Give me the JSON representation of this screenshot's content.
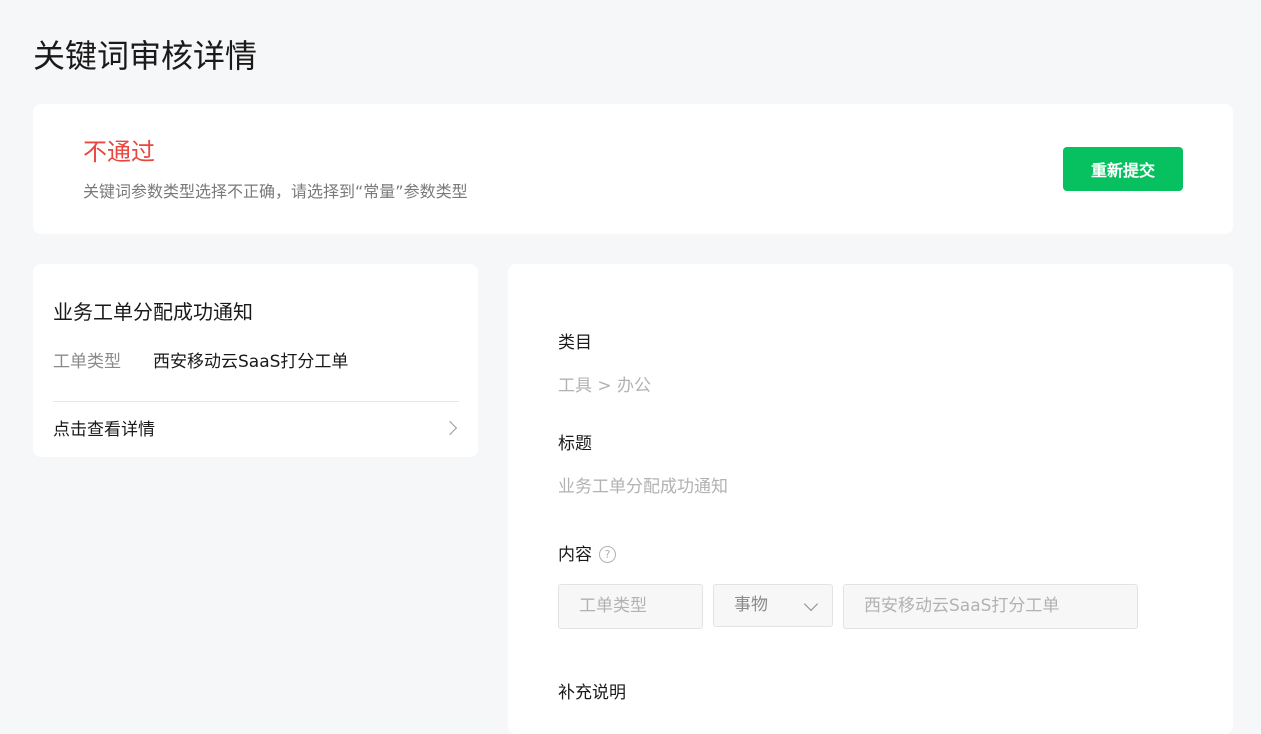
{
  "page": {
    "title": "关键词审核详情"
  },
  "status": {
    "title": "不通过",
    "reason": "关键词参数类型选择不正确，请选择到“常量”参数类型",
    "resubmit_label": "重新提交"
  },
  "preview": {
    "title": "业务工单分配成功通知",
    "field_label": "工单类型",
    "field_value": "西安移动云SaaS打分工单",
    "link_label": "点击查看详情"
  },
  "detail": {
    "category_label": "类目",
    "category_value": "工具 > 办公",
    "title_label": "标题",
    "title_value": "业务工单分配成功通知",
    "content_label": "内容",
    "help_glyph": "?",
    "keyword_name": "工单类型",
    "keyword_type": "事物",
    "keyword_example": "西安移动云SaaS打分工单",
    "note_label": "补充说明"
  },
  "colors": {
    "accent": "#07c160",
    "reject": "#e9463f",
    "background": "#f6f7f8"
  },
  "icons": {
    "help": "help-circle-icon",
    "link_arrow": "chevron-right-icon",
    "select_arrow": "chevron-down-icon"
  }
}
